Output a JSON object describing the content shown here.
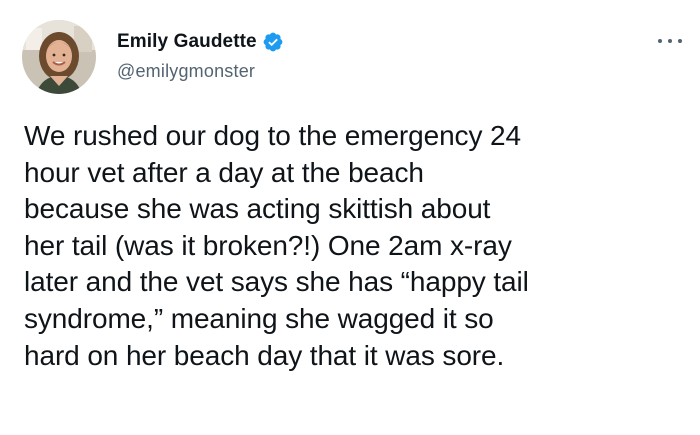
{
  "author": {
    "display_name": "Emily Gaudette",
    "handle": "@emilygmonster",
    "verified": true,
    "avatar_icon": "profile-photo",
    "verified_color": "#1d9bf0"
  },
  "menu": {
    "icon": "more-horizontal-icon"
  },
  "tweet": {
    "lines": [
      "We rushed our dog to the emergency 24",
      "hour vet after a day at the beach",
      "because she was acting skittish about",
      "her tail (was it broken?!) One 2am x-ray",
      "later and the vet says she has “happy tail",
      "syndrome,” meaning she wagged it so",
      "hard on her beach day that it was sore."
    ]
  },
  "colors": {
    "text": "#0f1419",
    "secondary": "#536471"
  }
}
